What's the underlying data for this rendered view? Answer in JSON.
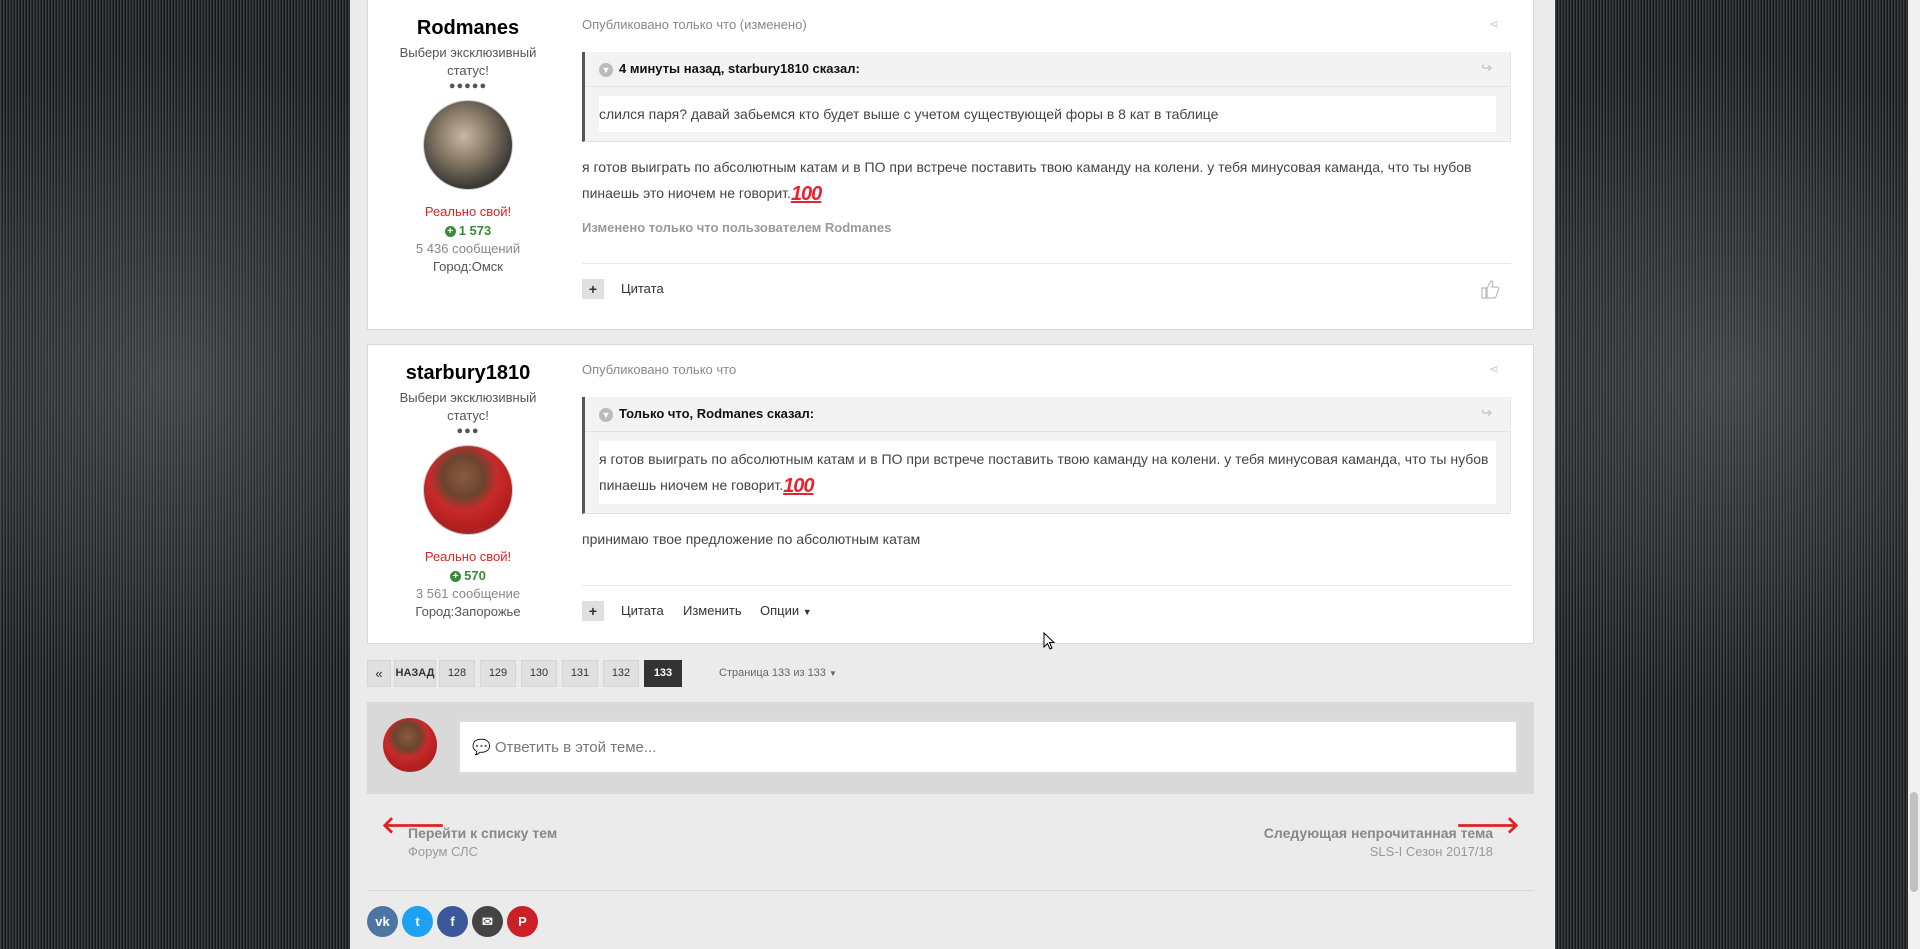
{
  "posts": [
    {
      "author": "Rodmanes",
      "title": "Выбери эксклюзивный статус!",
      "rank_dots": "●●●●●",
      "group": "Реально свой!",
      "reputation": "1 573",
      "post_count": "5 436 сообщений",
      "city": "Город:Омск",
      "meta": "Опубликовано только что (изменено)",
      "quote_header": "4 минуты назад, starbury1810 сказал:",
      "quote_text": "слился паря? давай забьемся кто будет выше с учетом существующей форы в 8 кат в таблице",
      "text": "я готов выиграть по абсолютным катам и в ПО при встрече поставить твою каманду на колени. у тебя минусовая каманда, что ты нубов пинаешь это ниочем не говорит.",
      "emoji": "100",
      "edited": "Изменено только что пользователем Rodmanes",
      "controls": {
        "quote": "Цитата"
      }
    },
    {
      "author": "starbury1810",
      "title": "Выбери эксклюзивный статус!",
      "rank_dots": "●●●",
      "group": "Реально свой!",
      "reputation": "570",
      "post_count": "3 561 сообщение",
      "city": "Город:Запорожье",
      "meta": "Опубликовано только что",
      "quote_header": "Только что, Rodmanes сказал:",
      "quote_text": "я готов выиграть по абсолютным катам и в ПО при встрече поставить твою каманду на колени. у тебя минусовая каманда, что ты нубов пинаешь ниочем не говорит.",
      "emoji": "100",
      "text": "принимаю твое предложение по абсолютным катам",
      "controls": {
        "quote": "Цитата",
        "edit": "Изменить",
        "options": "Опции"
      }
    }
  ],
  "pagination": {
    "first": "«",
    "prev": "НАЗАД",
    "pages": [
      "128",
      "129",
      "130",
      "131",
      "132",
      "133"
    ],
    "current": "133",
    "status": "Страница 133 из 133"
  },
  "reply": {
    "placeholder": "Ответить в этой теме..."
  },
  "nav": {
    "prev_title": "Перейти к списку тем",
    "prev_sub": "Форум СЛС",
    "next_title": "Следующая непрочитанная тема",
    "next_sub": "SLS-I Сезон 2017/18"
  },
  "social": [
    "vk",
    "twitter",
    "facebook",
    "email",
    "pinterest"
  ],
  "colors": {
    "accent_red": "#e02222",
    "reputation_green": "#3a8a3a",
    "page_active": "#333333"
  }
}
